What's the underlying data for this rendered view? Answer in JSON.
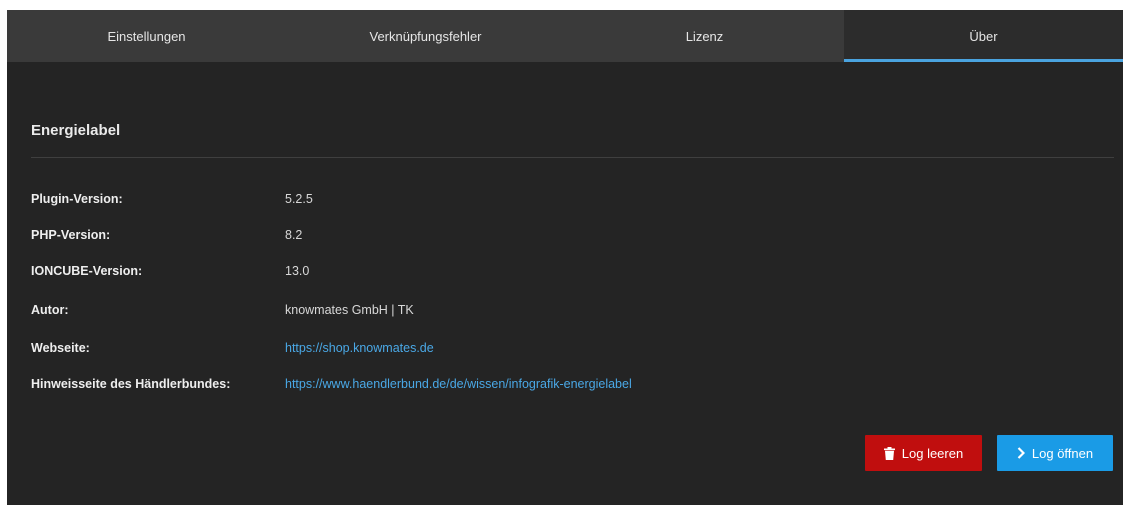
{
  "tabs": [
    {
      "label": "Einstellungen"
    },
    {
      "label": "Verknüpfungsfehler"
    },
    {
      "label": "Lizenz"
    },
    {
      "label": "Über"
    }
  ],
  "active_tab": "Über",
  "section": {
    "title": "Energielabel"
  },
  "info": [
    {
      "label": "Plugin-Version:",
      "value": "5.2.5"
    },
    {
      "label": "PHP-Version:",
      "value": "8.2"
    },
    {
      "label": "IONCUBE-Version:",
      "value": "13.0"
    },
    {
      "label": "Autor:",
      "value": "knowmates GmbH | TK"
    },
    {
      "label": "Webseite:",
      "value": "https://shop.knowmates.de"
    },
    {
      "label": "Hinweisseite des Händlerbundes:",
      "value": "https://www.haendlerbund.de/de/wissen/infografik-energielabel"
    }
  ],
  "buttons": {
    "clear_log": {
      "label": "Log leeren",
      "icon": "trash-icon",
      "color": "#c00e0e"
    },
    "open_log": {
      "label": "Log öffnen",
      "icon": "chevron-right-icon",
      "color": "#1a9be6"
    }
  },
  "colors": {
    "accent": "#4aa3df",
    "link": "#4aa8e6",
    "background": "#242424",
    "tabbar": "#3a3a3a"
  }
}
